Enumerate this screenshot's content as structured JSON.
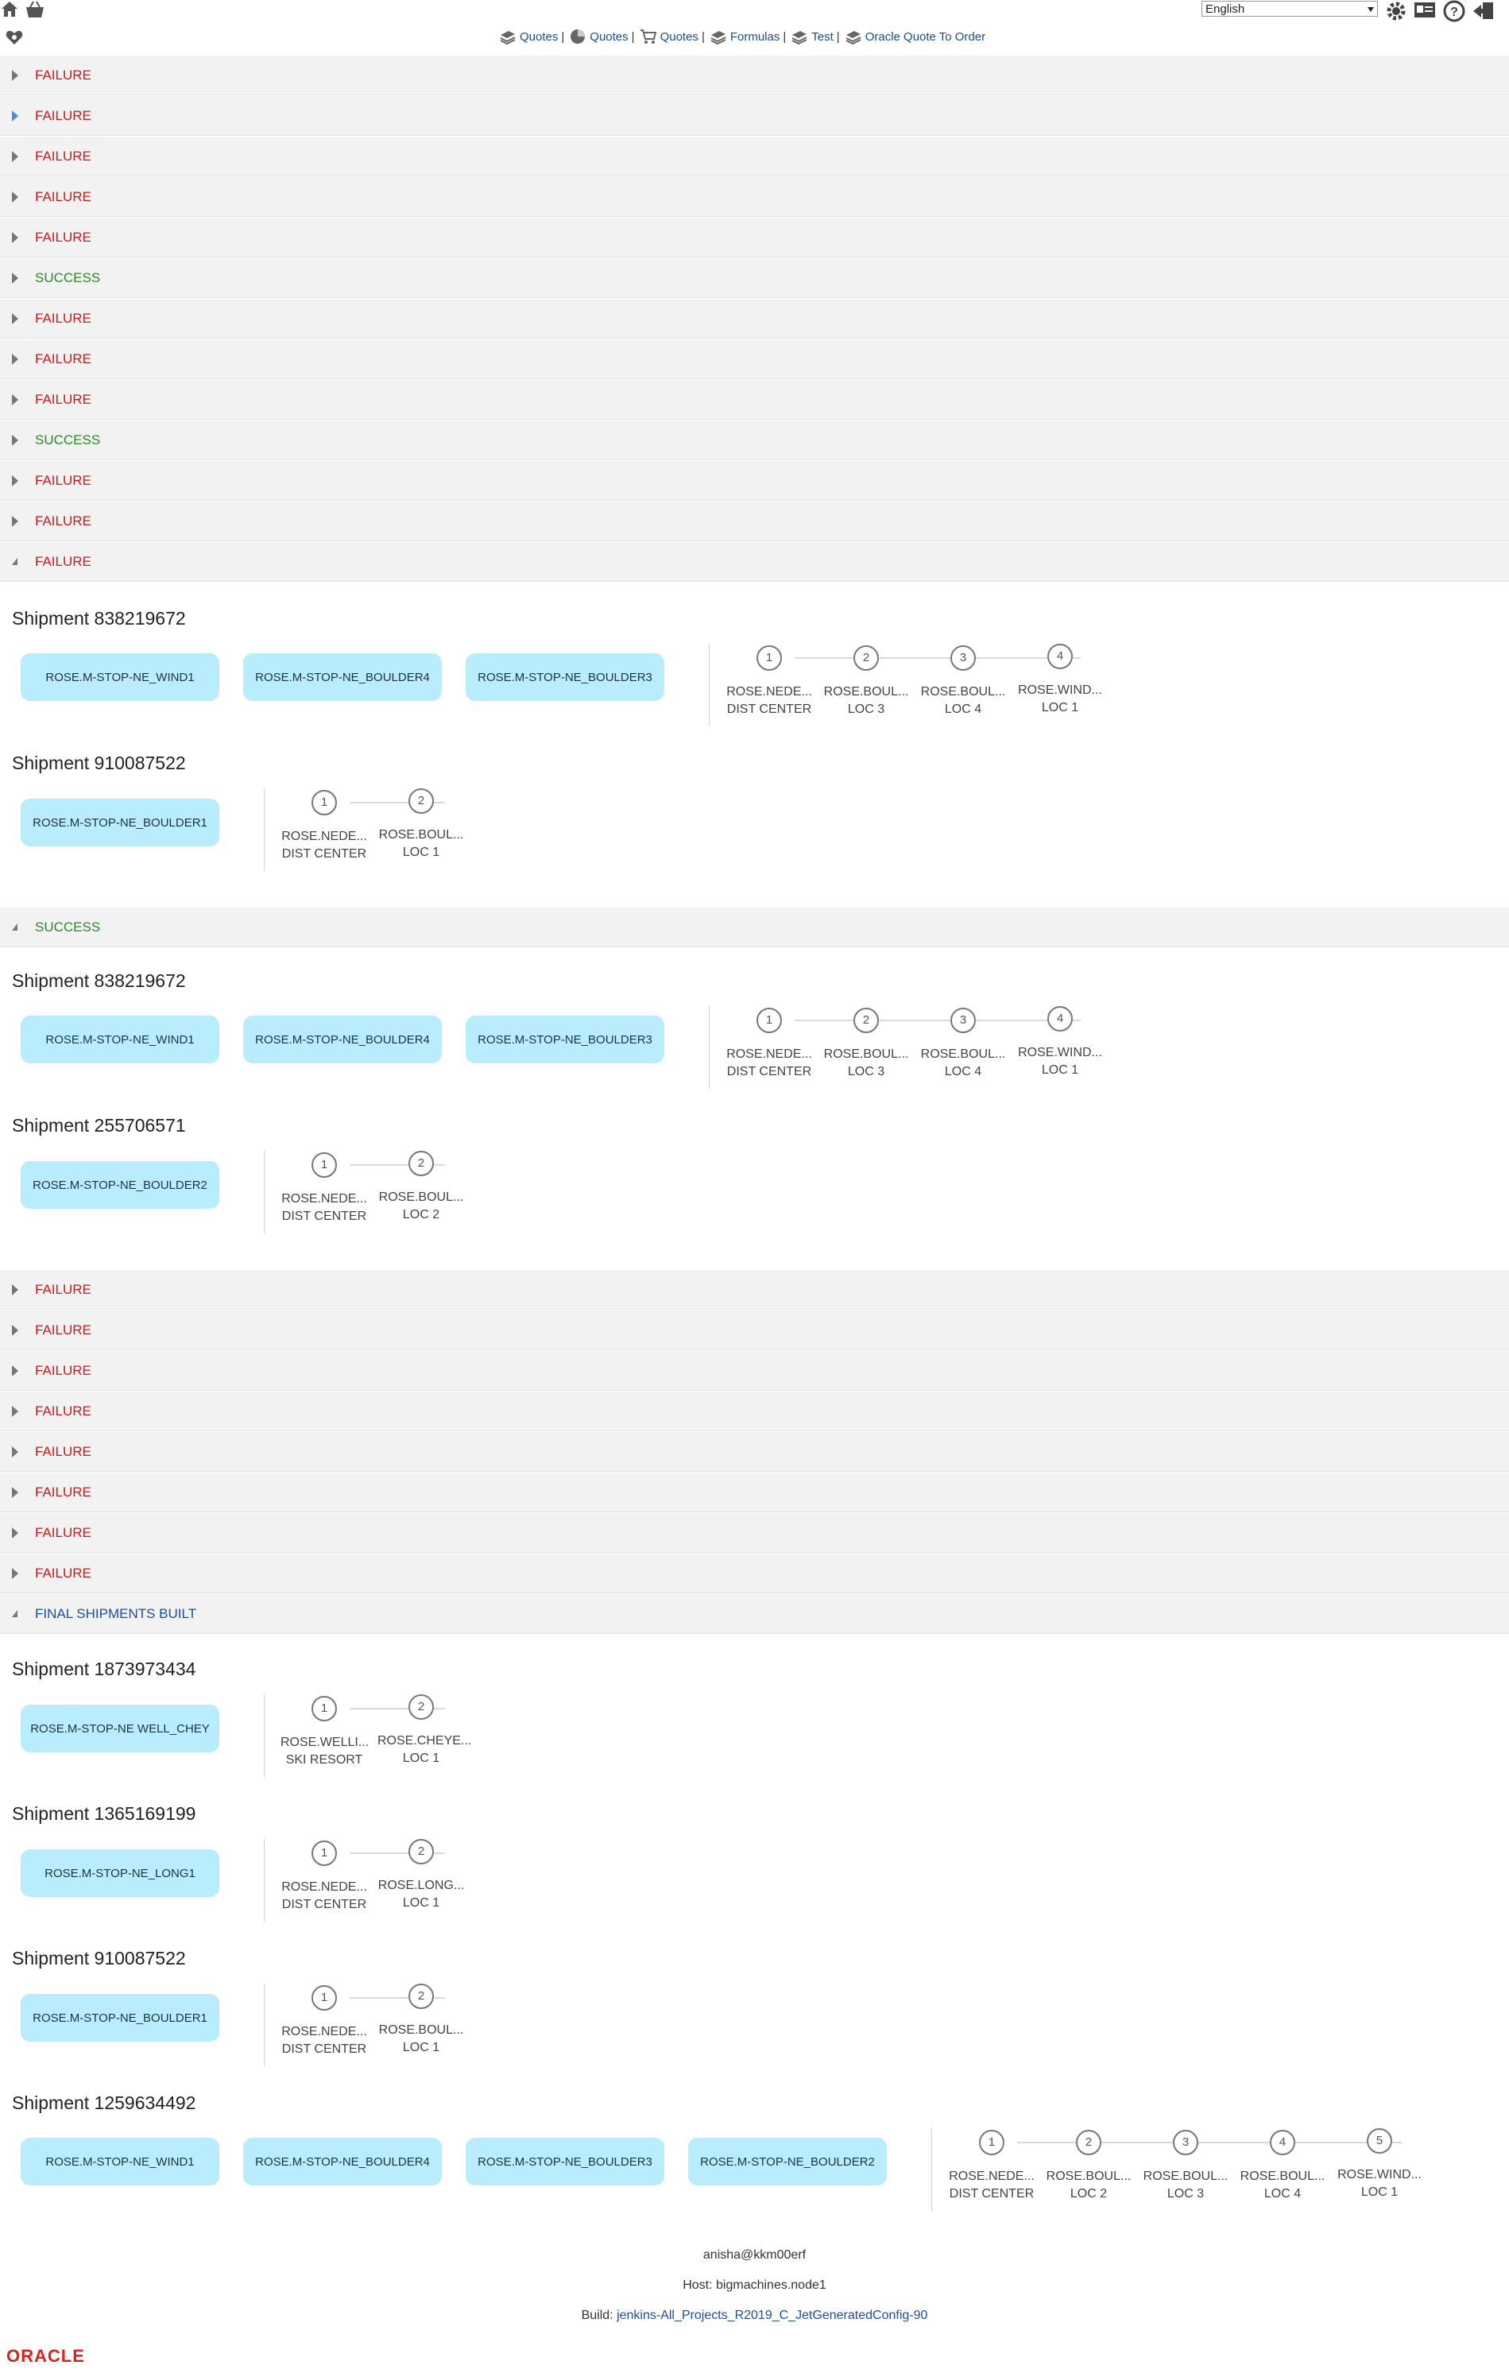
{
  "header": {
    "language": "English",
    "nav": [
      {
        "label": "Quotes",
        "icon": "books-icon"
      },
      {
        "label": "Quotes",
        "icon": "pie-chart-icon"
      },
      {
        "label": "Quotes",
        "icon": "cart-icon"
      },
      {
        "label": "Formulas",
        "icon": "books-icon"
      },
      {
        "label": "Test",
        "icon": "books-icon"
      },
      {
        "label": "Oracle Quote To Order",
        "icon": "books-icon"
      }
    ]
  },
  "groups": {
    "g0": "FAILURE",
    "g1": "FAILURE",
    "g2": "FAILURE",
    "g3": "FAILURE",
    "g4": "FAILURE",
    "g5": "SUCCESS",
    "g6": "FAILURE",
    "g7": "FAILURE",
    "g8": "FAILURE",
    "g9": "SUCCESS",
    "g10": "FAILURE",
    "g11": "FAILURE",
    "g12": "FAILURE",
    "g13": "SUCCESS",
    "g14": "FAILURE",
    "g15": "FAILURE",
    "g16": "FAILURE",
    "g17": "FAILURE",
    "g18": "FAILURE",
    "g19": "FAILURE",
    "g20": "FAILURE",
    "g21": "FAILURE",
    "g22": "FINAL SHIPMENTS BUILT"
  },
  "shipments": {
    "a1": {
      "title": "Shipment 838219672",
      "chips": [
        "ROSE.M-STOP-NE_WIND1",
        "ROSE.M-STOP-NE_BOULDER4",
        "ROSE.M-STOP-NE_BOULDER3"
      ],
      "stops": [
        {
          "n": "1",
          "name": "ROSE.NEDE...",
          "sub": "DIST CENTER"
        },
        {
          "n": "2",
          "name": "ROSE.BOUL...",
          "sub": "LOC 3"
        },
        {
          "n": "3",
          "name": "ROSE.BOUL...",
          "sub": "LOC 4"
        },
        {
          "n": "4",
          "name": "ROSE.WIND...",
          "sub": "LOC 1"
        }
      ]
    },
    "a2": {
      "title": "Shipment 910087522",
      "chips": [
        "ROSE.M-STOP-NE_BOULDER1"
      ],
      "stops": [
        {
          "n": "1",
          "name": "ROSE.NEDE...",
          "sub": "DIST CENTER"
        },
        {
          "n": "2",
          "name": "ROSE.BOUL...",
          "sub": "LOC 1"
        }
      ]
    },
    "b1": {
      "title": "Shipment 838219672",
      "chips": [
        "ROSE.M-STOP-NE_WIND1",
        "ROSE.M-STOP-NE_BOULDER4",
        "ROSE.M-STOP-NE_BOULDER3"
      ],
      "stops": [
        {
          "n": "1",
          "name": "ROSE.NEDE...",
          "sub": "DIST CENTER"
        },
        {
          "n": "2",
          "name": "ROSE.BOUL...",
          "sub": "LOC 3"
        },
        {
          "n": "3",
          "name": "ROSE.BOUL...",
          "sub": "LOC 4"
        },
        {
          "n": "4",
          "name": "ROSE.WIND...",
          "sub": "LOC 1"
        }
      ]
    },
    "b2": {
      "title": "Shipment 255706571",
      "chips": [
        "ROSE.M-STOP-NE_BOULDER2"
      ],
      "stops": [
        {
          "n": "1",
          "name": "ROSE.NEDE...",
          "sub": "DIST CENTER"
        },
        {
          "n": "2",
          "name": "ROSE.BOUL...",
          "sub": "LOC 2"
        }
      ]
    },
    "c1": {
      "title": "Shipment 1873973434",
      "chips": [
        "ROSE.M-STOP-NE WELL_CHEY"
      ],
      "stops": [
        {
          "n": "1",
          "name": "ROSE.WELLI...",
          "sub": "SKI RESORT"
        },
        {
          "n": "2",
          "name": "ROSE.CHEYE...",
          "sub": "LOC 1"
        }
      ]
    },
    "c2": {
      "title": "Shipment 1365169199",
      "chips": [
        "ROSE.M-STOP-NE_LONG1"
      ],
      "stops": [
        {
          "n": "1",
          "name": "ROSE.NEDE...",
          "sub": "DIST CENTER"
        },
        {
          "n": "2",
          "name": "ROSE.LONG...",
          "sub": "LOC 1"
        }
      ]
    },
    "c3": {
      "title": "Shipment 910087522",
      "chips": [
        "ROSE.M-STOP-NE_BOULDER1"
      ],
      "stops": [
        {
          "n": "1",
          "name": "ROSE.NEDE...",
          "sub": "DIST CENTER"
        },
        {
          "n": "2",
          "name": "ROSE.BOUL...",
          "sub": "LOC 1"
        }
      ]
    },
    "c4": {
      "title": "Shipment 1259634492",
      "chips": [
        "ROSE.M-STOP-NE_WIND1",
        "ROSE.M-STOP-NE_BOULDER4",
        "ROSE.M-STOP-NE_BOULDER3",
        "ROSE.M-STOP-NE_BOULDER2"
      ],
      "stops": [
        {
          "n": "1",
          "name": "ROSE.NEDE...",
          "sub": "DIST CENTER"
        },
        {
          "n": "2",
          "name": "ROSE.BOUL...",
          "sub": "LOC 2"
        },
        {
          "n": "3",
          "name": "ROSE.BOUL...",
          "sub": "LOC 3"
        },
        {
          "n": "4",
          "name": "ROSE.BOUL...",
          "sub": "LOC 4"
        },
        {
          "n": "5",
          "name": "ROSE.WIND...",
          "sub": "LOC 1"
        }
      ]
    }
  },
  "footer": {
    "user": "anisha@kkm00erf",
    "host": "Host: bigmachines.node1",
    "build_label": "Build: ",
    "build_link": "jenkins-All_Projects_R2019_C_JetGeneratedConfig-90",
    "brand": "ORACLE"
  },
  "colors": {
    "failure": "#d0181c",
    "success": "#2c8a2c",
    "final": "#1a4fa6",
    "chip": "#b9ecfc"
  }
}
